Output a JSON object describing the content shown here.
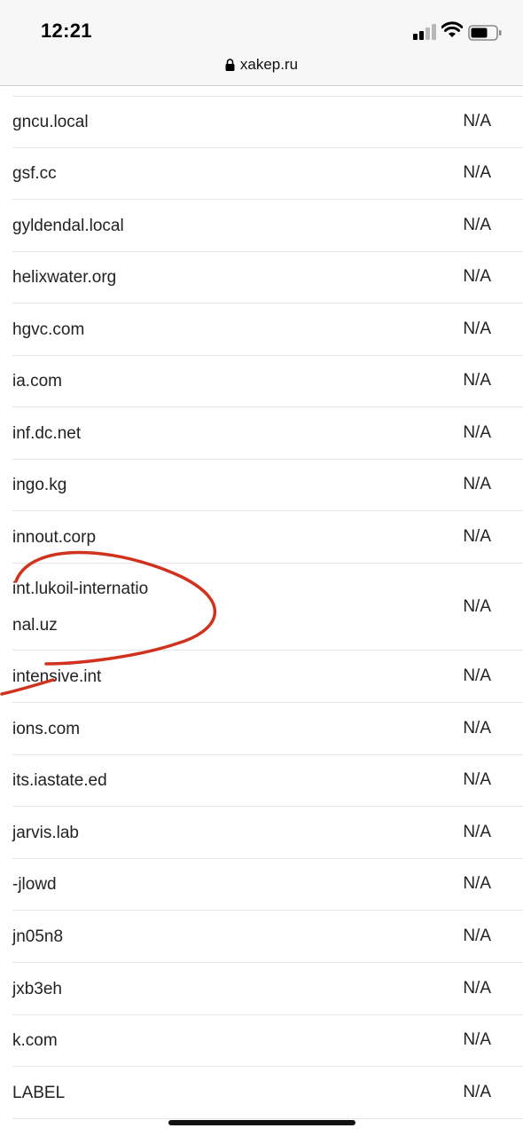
{
  "status": {
    "time": "12:21"
  },
  "browser": {
    "url": "xakep.ru"
  },
  "rows": [
    {
      "domain": "gncu.local",
      "value": "N/A"
    },
    {
      "domain": "gsf.cc",
      "value": "N/A"
    },
    {
      "domain": "gyldendal.local",
      "value": "N/A"
    },
    {
      "domain": "helixwater.org",
      "value": "N/A"
    },
    {
      "domain": "hgvc.com",
      "value": "N/A"
    },
    {
      "domain": "ia.com",
      "value": "N/A"
    },
    {
      "domain": "inf.dc.net",
      "value": "N/A"
    },
    {
      "domain": "ingo.kg",
      "value": "N/A"
    },
    {
      "domain": "innout.corp",
      "value": "N/A"
    },
    {
      "domain": "int.lukoil-international.uz",
      "value": "N/A"
    },
    {
      "domain": "intensive.int",
      "value": "N/A"
    },
    {
      "domain": "ions.com",
      "value": "N/A"
    },
    {
      "domain": "its.iastate.ed",
      "value": "N/A"
    },
    {
      "domain": "jarvis.lab",
      "value": "N/A"
    },
    {
      "domain": "-jlowd",
      "value": "N/A"
    },
    {
      "domain": "jn05n8",
      "value": "N/A"
    },
    {
      "domain": "jxb3eh",
      "value": "N/A"
    },
    {
      "domain": "k.com",
      "value": "N/A"
    },
    {
      "domain": "LABEL",
      "value": "N/A"
    }
  ],
  "annotation": {
    "color": "#d0321e"
  }
}
